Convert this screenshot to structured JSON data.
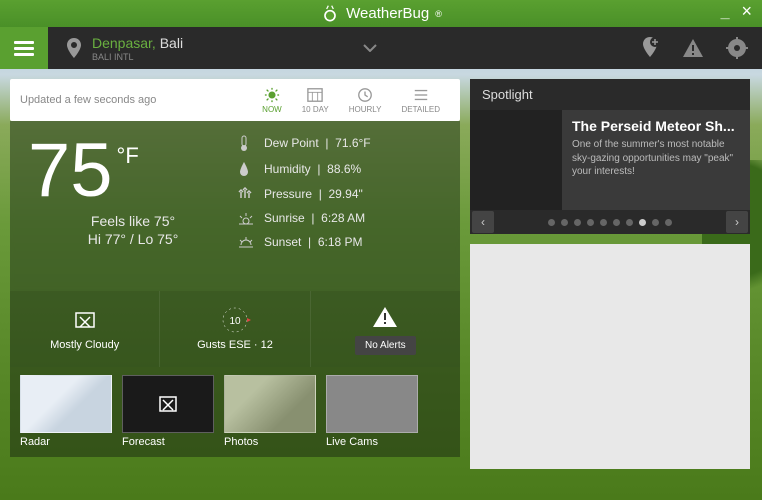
{
  "app": {
    "name": "WeatherBug"
  },
  "location": {
    "city": "Denpasar,",
    "region": "Bali",
    "sub": "BALI INTL"
  },
  "updated": "Updated a few seconds ago",
  "tabs": {
    "now": "NOW",
    "tenday": "10 DAY",
    "hourly": "HOURLY",
    "detailed": "DETAILED"
  },
  "weather": {
    "temp": "75",
    "unit": "°F",
    "feels": "Feels like 75°",
    "hilo": "Hi 77° / Lo 75°",
    "details": {
      "dew_label": "Dew Point",
      "dew_val": "71.6°F",
      "hum_label": "Humidity",
      "hum_val": "88.6%",
      "pres_label": "Pressure",
      "pres_val": "29.94\"",
      "sunrise_label": "Sunrise",
      "sunrise_val": "6:28 AM",
      "sunset_label": "Sunset",
      "sunset_val": "6:18 PM"
    }
  },
  "status": {
    "condition": "Mostly Cloudy",
    "wind": "Gusts ESE · 12",
    "wind_speed": "10",
    "alerts": "No Alerts"
  },
  "thumbs": {
    "radar": "Radar",
    "forecast": "Forecast",
    "photos": "Photos",
    "livecams": "Live Cams"
  },
  "spotlight": {
    "heading": "Spotlight",
    "title": "The Perseid Meteor Sh...",
    "desc": "One of the summer's most notable sky-gazing opportunities may \"peak\" your interests!"
  }
}
